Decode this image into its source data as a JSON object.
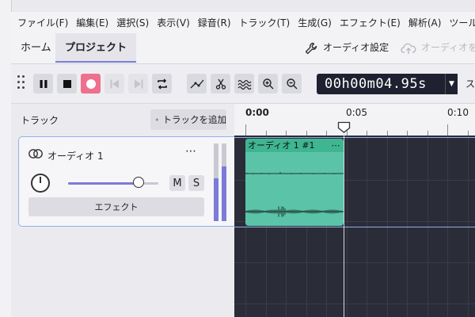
{
  "menu": [
    "ファイル(F)",
    "編集(E)",
    "選択(S)",
    "表示(V)",
    "録音(R)",
    "トラック(T)",
    "生成(G)",
    "エフェクト(E)",
    "解析(A)",
    "ツール(T)"
  ],
  "tabs": {
    "home": "ホーム",
    "project": "プロジェクト"
  },
  "audio_settings_label": "オーディオ設定",
  "share_audio_label": "オーディオを共有",
  "timecode": "00h00m04.95s",
  "snap_label": "スナ",
  "tracks_label": "トラック",
  "add_track_label": "トラックを追加",
  "track": {
    "name": "オーディオ 1",
    "menu": "⋯",
    "mute": "M",
    "solo": "S",
    "effect_label": "エフェクト",
    "volume_level": 0.78,
    "meter_levels": [
      0.55,
      0.7
    ]
  },
  "ruler": [
    "0:00",
    "0:05",
    "0:10"
  ],
  "clip": {
    "name": "オーディオ 1 #1",
    "menu": "⋯"
  },
  "colors": {
    "accent": "#7b7bd8",
    "record": "#ef6f8f",
    "clip": "#5bc4a8",
    "clip_header": "#3fb592",
    "timeline_bg": "#2a2c38",
    "selection": "#8fb2ea"
  }
}
